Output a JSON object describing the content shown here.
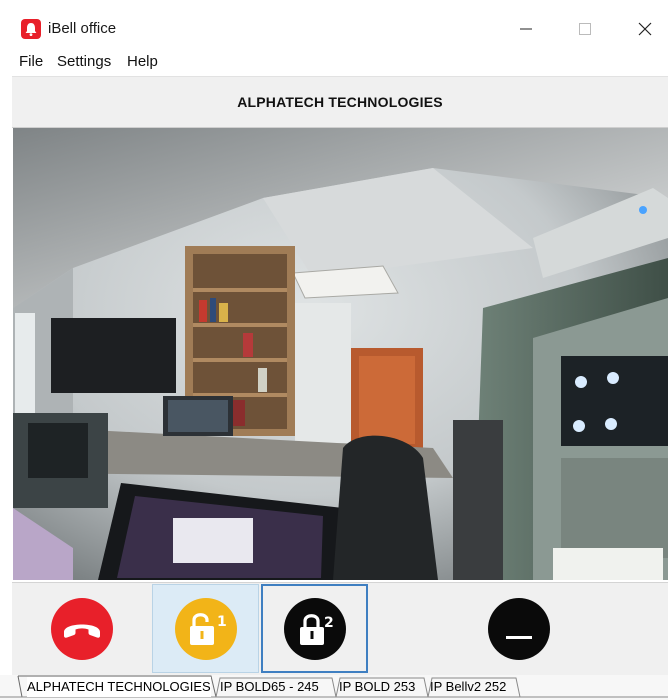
{
  "window": {
    "title": "iBell office"
  },
  "menu": {
    "file": "File",
    "settings": "Settings",
    "help": "Help"
  },
  "header": {
    "title": "ALPHATECH TECHNOLOGIES"
  },
  "controls": {
    "hangup_color": "#e8202a",
    "unlock1_color": "#f2b418",
    "unlock2_color": "#0a0a0a",
    "mute_color": "#0a0a0a",
    "unlock1_number": "1",
    "unlock2_number": "2"
  },
  "tabs": [
    "ALPHATECH TECHNOLOGIES",
    "IP BOLD65 - 245",
    "IP BOLD 253",
    "IP Bellv2 252"
  ]
}
